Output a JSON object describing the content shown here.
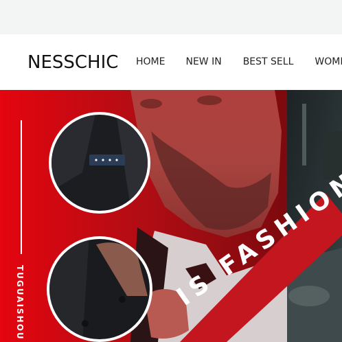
{
  "header": {
    "logo": "NESSCHIC",
    "nav": [
      {
        "label": "HOME"
      },
      {
        "label": "NEW IN"
      },
      {
        "label": "BEST SELL"
      },
      {
        "label": "WOME"
      }
    ]
  },
  "banner": {
    "vertical_text": "TUGUAISHOU",
    "slash_text": "IS FASHION"
  },
  "colors": {
    "topbar": "#f3f5f4",
    "banner_red": "#c8121b",
    "dark_red": "#8a0d12",
    "stripe": "#c4161e"
  }
}
